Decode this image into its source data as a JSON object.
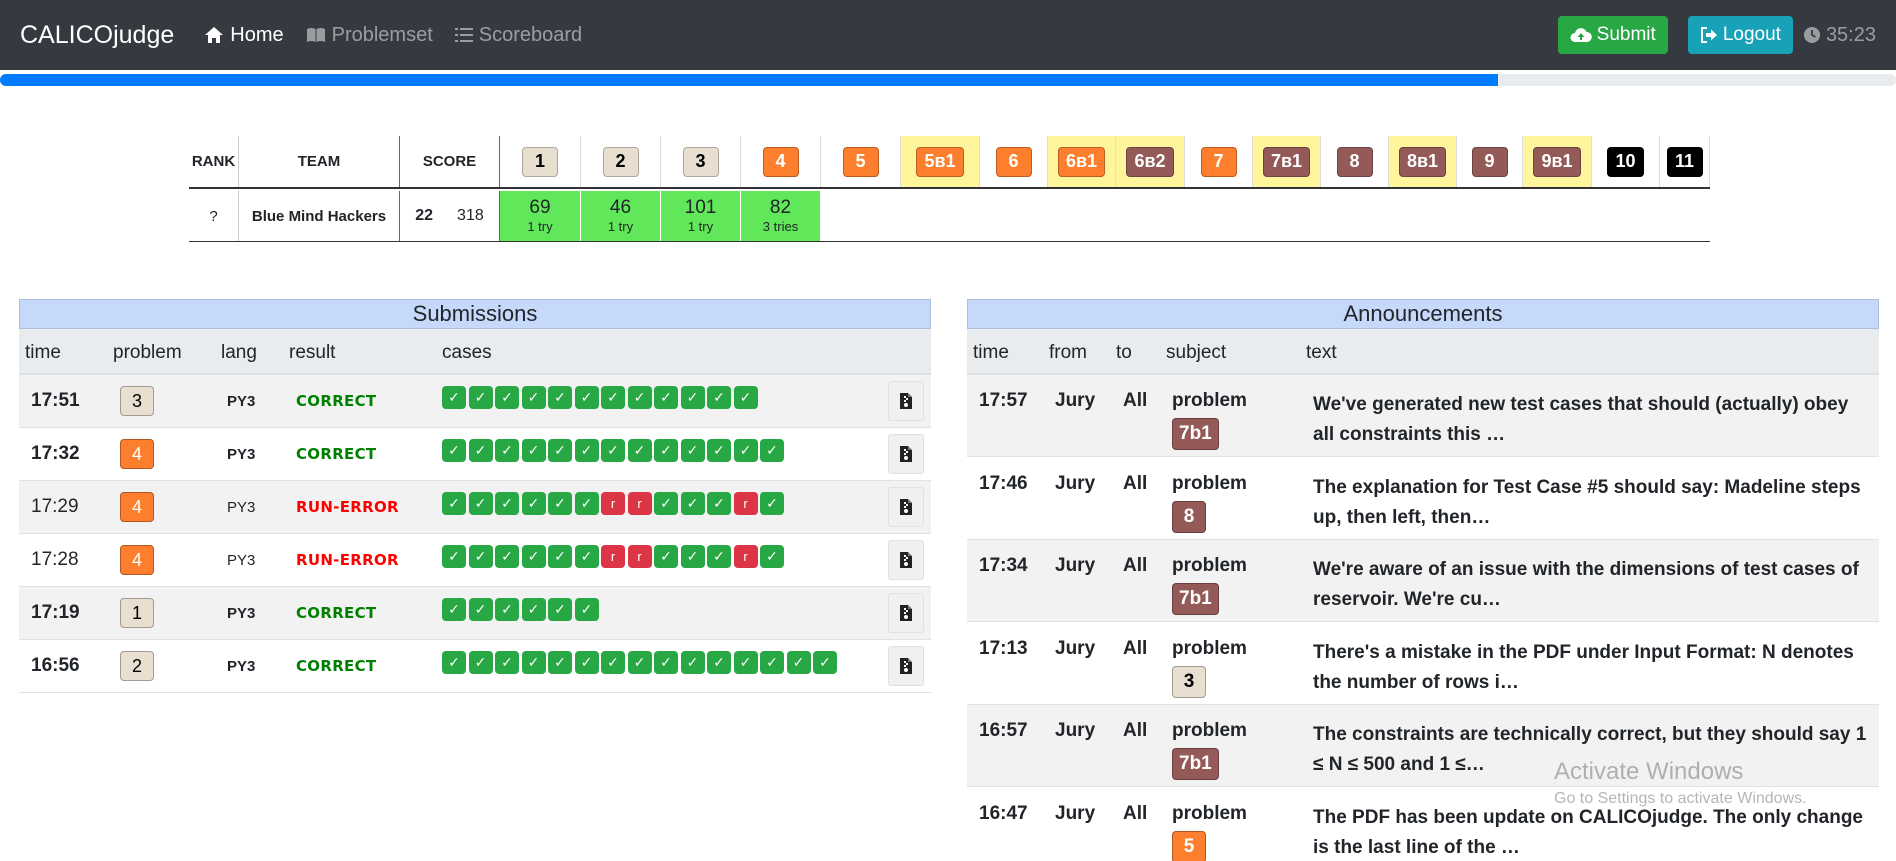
{
  "nav": {
    "brand": "CALICOjudge",
    "home": "Home",
    "problemset": "Problemset",
    "scoreboard": "Scoreboard",
    "submit": "Submit",
    "logout": "Logout",
    "time_left": "35:23",
    "contest_progress_fraction": 0.79
  },
  "scoreboard": {
    "headers": {
      "rank": "RANK",
      "team": "TEAM",
      "score": "SCORE"
    },
    "problems": [
      {
        "label": "1",
        "bg": "#e8dfd0",
        "fg": "#000000",
        "highlight": false
      },
      {
        "label": "2",
        "bg": "#e8dfd0",
        "fg": "#000000",
        "highlight": false
      },
      {
        "label": "3",
        "bg": "#e8dfd0",
        "fg": "#000000",
        "highlight": false
      },
      {
        "label": "4",
        "bg": "#fd7e2d",
        "fg": "#ffffff",
        "highlight": false
      },
      {
        "label": "5",
        "bg": "#fd7e2d",
        "fg": "#ffffff",
        "highlight": false
      },
      {
        "label": "5в1",
        "bg": "#fd7e2d",
        "fg": "#ffffff",
        "highlight": true
      },
      {
        "label": "6",
        "bg": "#fd7e2d",
        "fg": "#ffffff",
        "highlight": false
      },
      {
        "label": "6в1",
        "bg": "#fd7e2d",
        "fg": "#ffffff",
        "highlight": true
      },
      {
        "label": "6в2",
        "bg": "#945a58",
        "fg": "#ffffff",
        "highlight": true
      },
      {
        "label": "7",
        "bg": "#fd7e2d",
        "fg": "#ffffff",
        "highlight": false
      },
      {
        "label": "7в1",
        "bg": "#945a58",
        "fg": "#ffffff",
        "highlight": true
      },
      {
        "label": "8",
        "bg": "#945a58",
        "fg": "#ffffff",
        "highlight": false
      },
      {
        "label": "8в1",
        "bg": "#945a58",
        "fg": "#ffffff",
        "highlight": true
      },
      {
        "label": "9",
        "bg": "#945a58",
        "fg": "#ffffff",
        "highlight": false
      },
      {
        "label": "9в1",
        "bg": "#945a58",
        "fg": "#ffffff",
        "highlight": true
      },
      {
        "label": "10",
        "bg": "#000000",
        "fg": "#ffffff",
        "highlight": false
      },
      {
        "label": "11",
        "bg": "#000000",
        "fg": "#ffffff",
        "highlight": false
      }
    ],
    "team": {
      "rank": "?",
      "name": "Blue Mind Hackers",
      "solved": "22",
      "penalty": "318",
      "results": [
        {
          "points": "69",
          "tries": "1 try"
        },
        {
          "points": "46",
          "tries": "1 try"
        },
        {
          "points": "101",
          "tries": "1 try"
        },
        {
          "points": "82",
          "tries": "3 tries"
        }
      ]
    }
  },
  "submissions": {
    "title": "Submissions",
    "headers": {
      "time": "time",
      "problem": "problem",
      "lang": "lang",
      "result": "result",
      "cases": "cases"
    },
    "rows": [
      {
        "time": "17:51",
        "problem": "3",
        "prob_bg": "#e8dfd0",
        "prob_fg": "#000000",
        "lang": "PY3",
        "result": "CORRECT",
        "status": "ok",
        "cases": "pppppppppppp",
        "bold": true
      },
      {
        "time": "17:32",
        "problem": "4",
        "prob_bg": "#fd7e2d",
        "prob_fg": "#ffffff",
        "lang": "PY3",
        "result": "CORRECT",
        "status": "ok",
        "cases": "ppppppppppppp",
        "bold": true
      },
      {
        "time": "17:29",
        "problem": "4",
        "prob_bg": "#fd7e2d",
        "prob_fg": "#ffffff",
        "lang": "PY3",
        "result": "RUN-ERROR",
        "status": "err",
        "cases": "ppppppffpppfp",
        "bold": false
      },
      {
        "time": "17:28",
        "problem": "4",
        "prob_bg": "#fd7e2d",
        "prob_fg": "#ffffff",
        "lang": "PY3",
        "result": "RUN-ERROR",
        "status": "err",
        "cases": "ppppppffpppfp",
        "bold": false
      },
      {
        "time": "17:19",
        "problem": "1",
        "prob_bg": "#e8dfd0",
        "prob_fg": "#000000",
        "lang": "PY3",
        "result": "CORRECT",
        "status": "ok",
        "cases": "pppppp",
        "bold": true
      },
      {
        "time": "16:56",
        "problem": "2",
        "prob_bg": "#e8dfd0",
        "prob_fg": "#000000",
        "lang": "PY3",
        "result": "CORRECT",
        "status": "ok",
        "cases": "ppppppppppppppp",
        "bold": true
      }
    ],
    "pass_glyph": "✓",
    "fail_glyph": "r"
  },
  "announcements": {
    "title": "Announcements",
    "headers": {
      "time": "time",
      "from": "from",
      "to": "to",
      "subject": "subject",
      "text": "text"
    },
    "rows": [
      {
        "time": "17:57",
        "from": "Jury",
        "to": "All",
        "subject": "problem",
        "problem": "7b1",
        "prob_bg": "#945a58",
        "prob_fg": "#ffffff",
        "text": "We've generated new test cases that should (actually) obey all constraints this …"
      },
      {
        "time": "17:46",
        "from": "Jury",
        "to": "All",
        "subject": "problem",
        "problem": "8",
        "prob_bg": "#945a58",
        "prob_fg": "#ffffff",
        "text": "The explanation for Test Case #5 should say: Madeline steps up, then left, then…"
      },
      {
        "time": "17:34",
        "from": "Jury",
        "to": "All",
        "subject": "problem",
        "problem": "7b1",
        "prob_bg": "#945a58",
        "prob_fg": "#ffffff",
        "text": "We're aware of an issue with the dimensions of test cases of reservoir. We're cu…"
      },
      {
        "time": "17:13",
        "from": "Jury",
        "to": "All",
        "subject": "problem",
        "problem": "3",
        "prob_bg": "#e8dfd0",
        "prob_fg": "#000000",
        "text": "There's a mistake in the PDF under Input Format: N denotes the number of rows i…"
      },
      {
        "time": "16:57",
        "from": "Jury",
        "to": "All",
        "subject": "problem",
        "problem": "7b1",
        "prob_bg": "#945a58",
        "prob_fg": "#ffffff",
        "text": "The constraints are technically correct, but they should say 1 ≤ N ≤ 500 and 1 ≤…"
      },
      {
        "time": "16:47",
        "from": "Jury",
        "to": "All",
        "subject": "problem",
        "problem": "5",
        "prob_bg": "#fd7e2d",
        "prob_fg": "#ffffff",
        "text": "The PDF has been update on CALICOjudge. The only change is the last line of the …"
      }
    ]
  },
  "watermark": {
    "line1": "Activate Windows",
    "line2": "Go to Settings to activate Windows."
  },
  "icons": {
    "home": "home-icon",
    "book": "book-icon",
    "list": "list-icon",
    "upload": "cloud-upload-icon",
    "logout": "sign-out-icon",
    "clock": "clock-icon",
    "download": "download-file-icon"
  }
}
